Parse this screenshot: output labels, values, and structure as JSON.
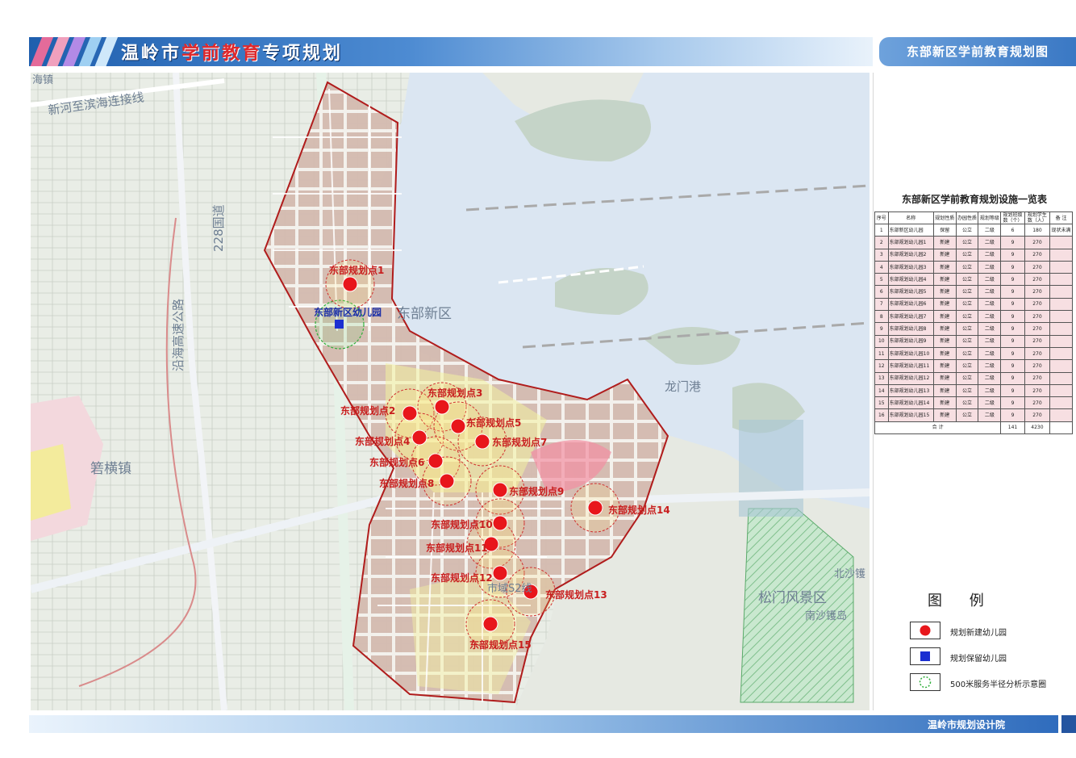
{
  "header": {
    "title_prefix": "温岭市",
    "title_highlight": "学前教育",
    "title_suffix": "专项规划",
    "subtitle": "东部新区学前教育规划图"
  },
  "map": {
    "place_labels": {
      "top_left": "海镇",
      "road_link": "新河至滨海连接线",
      "national_road": "228国道",
      "expressway": "沿海高速公路",
      "district": "东部新区",
      "harbor": "龙门港",
      "town": "箬横镇",
      "scenic": "松门风景区",
      "north_town": "北沙镬",
      "south_island": "南沙镬岛",
      "city_road": "市域S2线"
    },
    "existing_site": "东部新区幼儿园",
    "planned_sites": [
      "东部规划点1",
      "东部规划点2",
      "东部规划点3",
      "东部规划点4",
      "东部规划点5",
      "东部规划点6",
      "东部规划点7",
      "东部规划点8",
      "东部规划点9",
      "东部规划点10",
      "东部规划点11",
      "东部规划点12",
      "东部规划点13",
      "东部规划点14",
      "东部规划点15"
    ]
  },
  "table": {
    "title": "东部新区学前教育规划设施一览表",
    "headers": [
      "序号",
      "名称",
      "规划性质",
      "办园性质",
      "规划等级",
      "规划班级数（个）",
      "规划学生数（人）",
      "备 注"
    ],
    "rows": [
      [
        "1",
        "东部新区幼儿园",
        "保留",
        "公立",
        "二级",
        "6",
        "180",
        "现状未满"
      ],
      [
        "2",
        "东部规划幼儿园1",
        "新建",
        "公立",
        "二级",
        "9",
        "270",
        ""
      ],
      [
        "3",
        "东部规划幼儿园2",
        "新建",
        "公立",
        "二级",
        "9",
        "270",
        ""
      ],
      [
        "4",
        "东部规划幼儿园3",
        "新建",
        "公立",
        "二级",
        "9",
        "270",
        ""
      ],
      [
        "5",
        "东部规划幼儿园4",
        "新建",
        "公立",
        "二级",
        "9",
        "270",
        ""
      ],
      [
        "6",
        "东部规划幼儿园5",
        "新建",
        "公立",
        "二级",
        "9",
        "270",
        ""
      ],
      [
        "7",
        "东部规划幼儿园6",
        "新建",
        "公立",
        "二级",
        "9",
        "270",
        ""
      ],
      [
        "8",
        "东部规划幼儿园7",
        "新建",
        "公立",
        "二级",
        "9",
        "270",
        ""
      ],
      [
        "9",
        "东部规划幼儿园8",
        "新建",
        "公立",
        "二级",
        "9",
        "270",
        ""
      ],
      [
        "10",
        "东部规划幼儿园9",
        "新建",
        "公立",
        "二级",
        "9",
        "270",
        ""
      ],
      [
        "11",
        "东部规划幼儿园10",
        "新建",
        "公立",
        "二级",
        "9",
        "270",
        ""
      ],
      [
        "12",
        "东部规划幼儿园11",
        "新建",
        "公立",
        "二级",
        "9",
        "270",
        ""
      ],
      [
        "13",
        "东部规划幼儿园12",
        "新建",
        "公立",
        "二级",
        "9",
        "270",
        ""
      ],
      [
        "14",
        "东部规划幼儿园13",
        "新建",
        "公立",
        "二级",
        "9",
        "270",
        ""
      ],
      [
        "15",
        "东部规划幼儿园14",
        "新建",
        "公立",
        "二级",
        "9",
        "270",
        ""
      ],
      [
        "16",
        "东部规划幼儿园15",
        "新建",
        "公立",
        "二级",
        "9",
        "270",
        ""
      ]
    ],
    "total_label": "合  计",
    "total_classes": "141",
    "total_students": "4230"
  },
  "legend": {
    "title": "图  例",
    "new": "规划新建幼儿园",
    "retained": "规划保留幼儿园",
    "radius": "500米服务半径分析示意圈"
  },
  "footer": {
    "org": "温岭市规划设计院"
  },
  "colors": {
    "planned": "#e8161b",
    "retained": "#1b2fd1",
    "radius_ring": "#d03030",
    "boundary": "#b01c1c",
    "sea": "#dbe6f2"
  }
}
